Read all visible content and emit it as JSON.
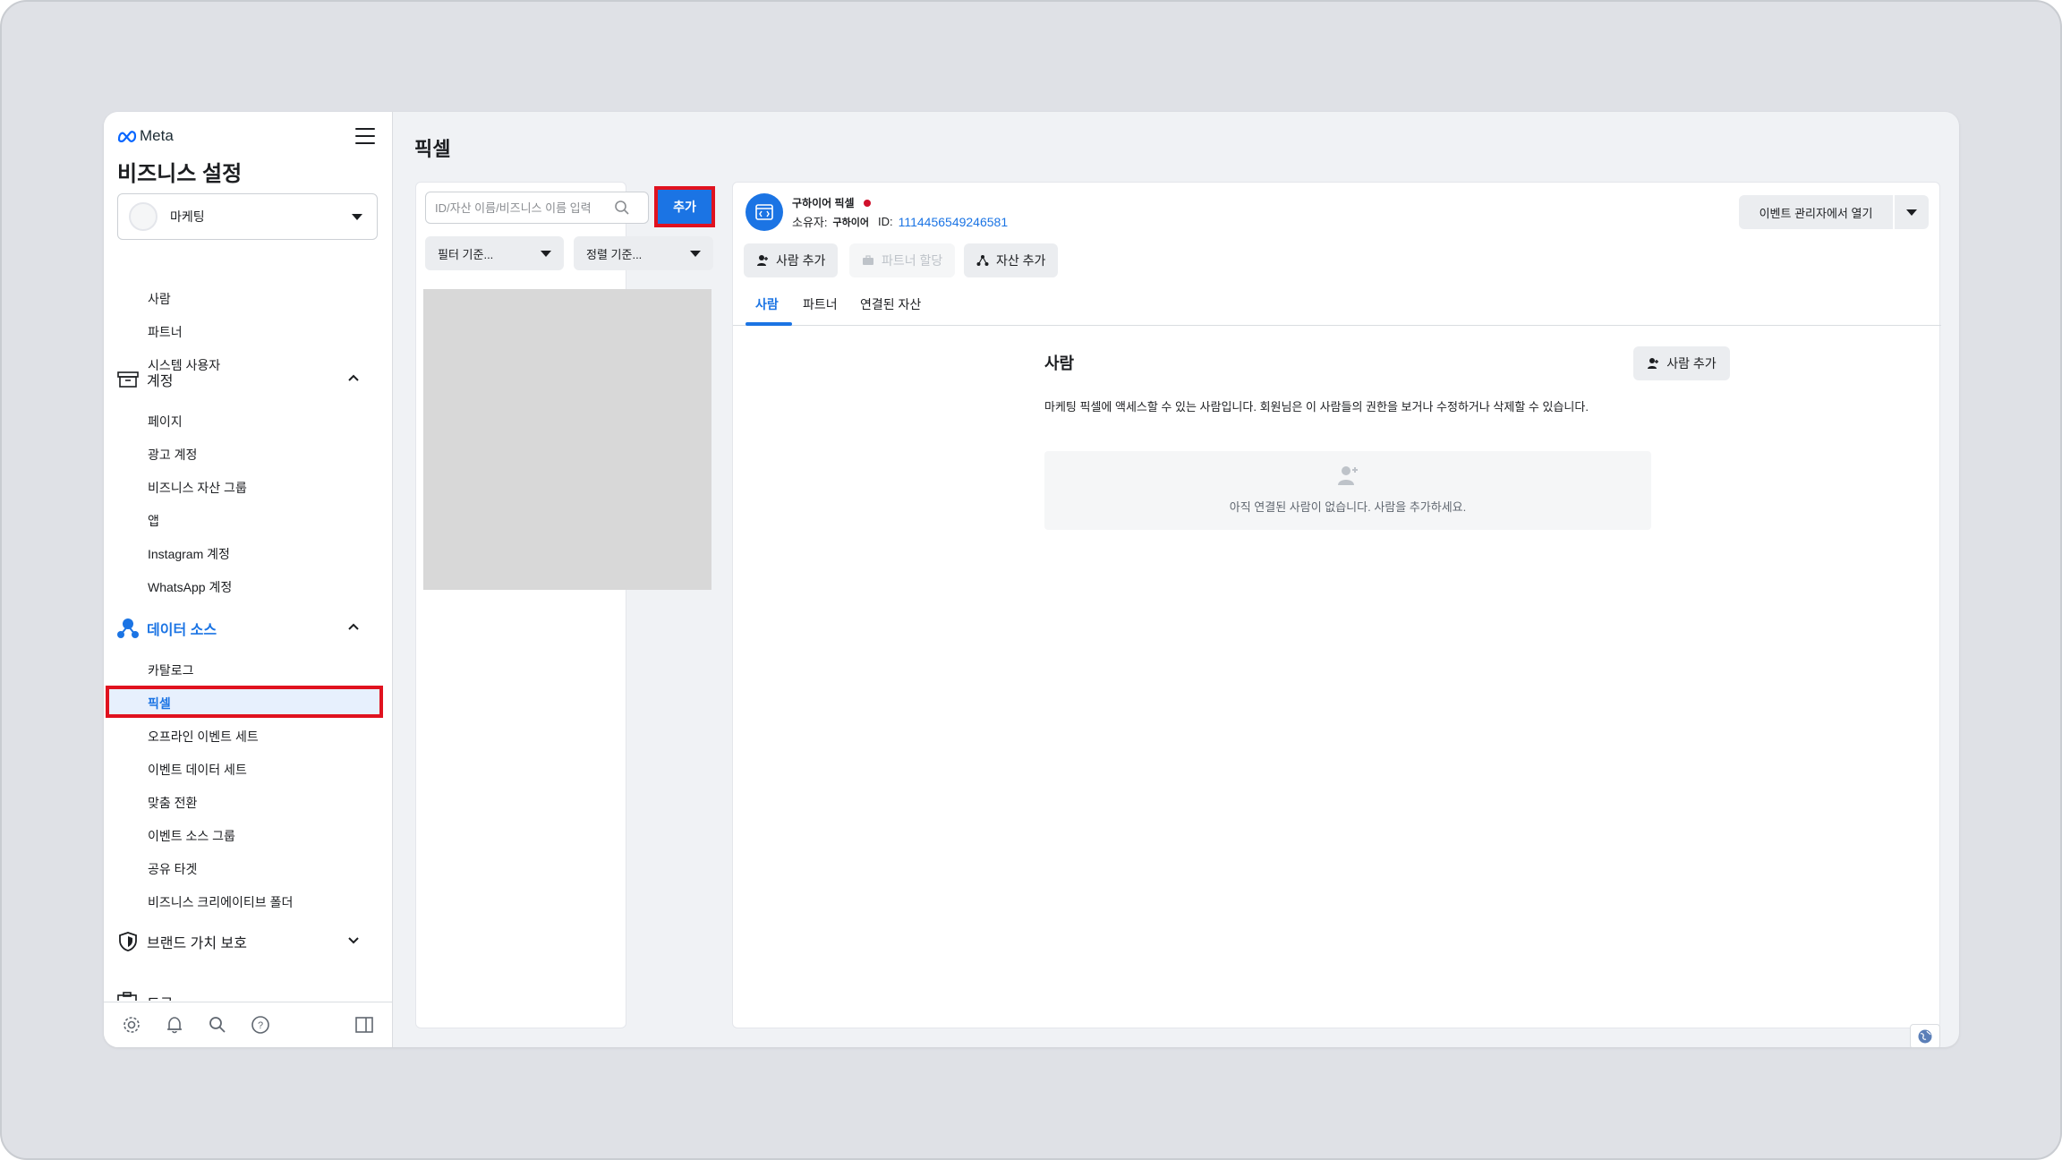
{
  "brand": {
    "logo_text": "Meta"
  },
  "sidebar": {
    "title": "비즈니스 설정",
    "business_selector": "마케팅",
    "users_items": [
      "사람",
      "파트너",
      "시스템 사용자"
    ],
    "accounts_section": "계정",
    "accounts_items": [
      "페이지",
      "광고 계정",
      "비즈니스 자산 그룹",
      "앱",
      "Instagram 계정",
      "WhatsApp 계정"
    ],
    "data_sources_section": "데이터 소스",
    "data_sources_items": [
      "카탈로그",
      "픽셀",
      "오프라인 이벤트 세트",
      "이벤트 데이터 세트",
      "맞춤 전환",
      "이벤트 소스 그룹",
      "공유 타겟",
      "비즈니스 크리에이티브 폴더"
    ],
    "brand_safety_section": "브랜드 가치 보호",
    "cut_section": "도구"
  },
  "main": {
    "page_title": "픽셀",
    "list": {
      "search_placeholder": "ID/자산 이름/비즈니스 이름 입력",
      "add_button": "추가",
      "filter_dropdown": "필터 기준...",
      "sort_dropdown": "정렬 기준..."
    },
    "detail": {
      "pixel_name": "구하이어 픽셀",
      "owner_label": "소유자:",
      "owner_name": "구하이어",
      "id_label": "ID:",
      "pixel_id": "1114456549246581",
      "open_button": "이벤트 관리자에서 열기",
      "actions": [
        "사람 추가",
        "파트너 할당",
        "자산 추가"
      ],
      "tabs": [
        "사람",
        "파트너",
        "연결된 자산"
      ],
      "people": {
        "title": "사람",
        "add_button": "사람 추가",
        "description": "마케팅 픽셀에 액세스할 수 있는 사람입니다. 회원님은 이 사람들의 권한을 보거나 수정하거나 삭제할 수 있습니다.",
        "empty_text": "아직 연결된 사람이 없습니다. 사람을 추가하세요."
      }
    }
  },
  "colors": {
    "accent": "#1b74e4",
    "highlight": "#e0121f",
    "selected_bg": "#e7f0fd"
  }
}
